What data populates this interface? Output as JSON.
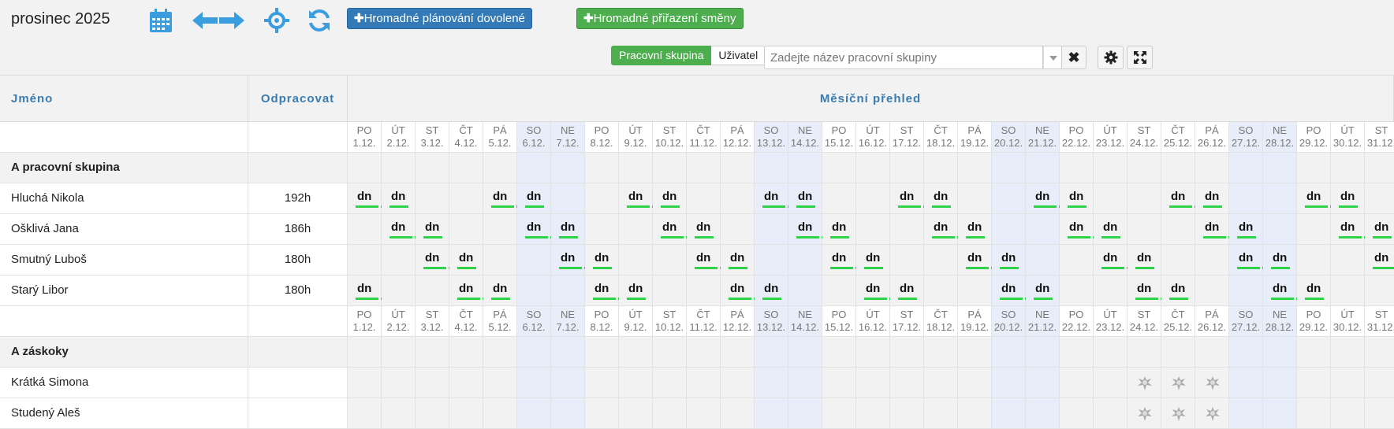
{
  "toolbar": {
    "month": "prosinec 2025",
    "bulk_vacation_label": "Hromadné plánování dovolené",
    "bulk_shift_label": "Hromadné přiřazení směny",
    "filter_group_label": "Pracovní skupina",
    "filter_user_label": "Uživatel",
    "search_placeholder": "Zadejte název pracovní skupiny"
  },
  "icons": [
    "calendar-icon",
    "arrow-left-icon",
    "arrow-right-icon",
    "crosshair-icon",
    "refresh-icon",
    "close-icon",
    "gear-icon",
    "fullscreen-icon",
    "vacation-icon"
  ],
  "colors": {
    "accent_blue": "#337ab7",
    "accent_green": "#4cae4c",
    "shift_underline": "#2fd34a",
    "weekend": "#e8eef9",
    "header_text": "#3a7cb0"
  },
  "columns": {
    "name": "Jméno",
    "hours": "Odpracovat",
    "overview": "Měsíční přehled"
  },
  "days": [
    {
      "dow": "PO",
      "date": "1.12."
    },
    {
      "dow": "ÚT",
      "date": "2.12."
    },
    {
      "dow": "ST",
      "date": "3.12."
    },
    {
      "dow": "ČT",
      "date": "4.12."
    },
    {
      "dow": "PÁ",
      "date": "5.12."
    },
    {
      "dow": "SO",
      "date": "6.12."
    },
    {
      "dow": "NE",
      "date": "7.12."
    },
    {
      "dow": "PO",
      "date": "8.12."
    },
    {
      "dow": "ÚT",
      "date": "9.12."
    },
    {
      "dow": "ST",
      "date": "10.12."
    },
    {
      "dow": "ČT",
      "date": "11.12."
    },
    {
      "dow": "PÁ",
      "date": "12.12."
    },
    {
      "dow": "SO",
      "date": "13.12."
    },
    {
      "dow": "NE",
      "date": "14.12."
    },
    {
      "dow": "PO",
      "date": "15.12."
    },
    {
      "dow": "ÚT",
      "date": "16.12."
    },
    {
      "dow": "ST",
      "date": "17.12."
    },
    {
      "dow": "ČT",
      "date": "18.12."
    },
    {
      "dow": "PÁ",
      "date": "19.12."
    },
    {
      "dow": "SO",
      "date": "20.12."
    },
    {
      "dow": "NE",
      "date": "21.12."
    },
    {
      "dow": "PO",
      "date": "22.12."
    },
    {
      "dow": "ÚT",
      "date": "23.12."
    },
    {
      "dow": "ST",
      "date": "24.12."
    },
    {
      "dow": "ČT",
      "date": "25.12."
    },
    {
      "dow": "PÁ",
      "date": "26.12."
    },
    {
      "dow": "SO",
      "date": "27.12."
    },
    {
      "dow": "NE",
      "date": "28.12."
    },
    {
      "dow": "PO",
      "date": "29.12."
    },
    {
      "dow": "ÚT",
      "date": "30.12."
    },
    {
      "dow": "ST",
      "date": "31.12."
    }
  ],
  "weekend_days": [
    6,
    7,
    13,
    14,
    20,
    21,
    27,
    28
  ],
  "shift_code": "dn",
  "groups": [
    {
      "label": "A pracovní skupina",
      "members": [
        {
          "name": "Hluchá Nikola",
          "hours": "192h",
          "shifts": [
            1,
            2,
            5,
            6,
            9,
            10,
            13,
            14,
            17,
            18,
            21,
            22,
            25,
            26,
            29,
            30
          ]
        },
        {
          "name": "Ošklivá Jana",
          "hours": "186h",
          "shifts": [
            2,
            3,
            6,
            7,
            10,
            11,
            14,
            15,
            18,
            19,
            22,
            23,
            26,
            27,
            30,
            31
          ]
        },
        {
          "name": "Smutný Luboš",
          "hours": "180h",
          "shifts": [
            3,
            4,
            7,
            8,
            11,
            12,
            15,
            16,
            19,
            20,
            23,
            24,
            27,
            28,
            31
          ]
        },
        {
          "name": "Starý Libor",
          "hours": "180h",
          "shifts": [
            1,
            4,
            5,
            8,
            9,
            12,
            13,
            16,
            17,
            20,
            21,
            24,
            25,
            28,
            29
          ]
        }
      ]
    },
    {
      "label": "A záskoky",
      "members": [
        {
          "name": "Krátká Simona",
          "hours": "",
          "vacations": [
            24,
            25,
            26
          ]
        },
        {
          "name": "Studený Aleš",
          "hours": "",
          "vacations": [
            24,
            25,
            26
          ]
        }
      ]
    }
  ]
}
